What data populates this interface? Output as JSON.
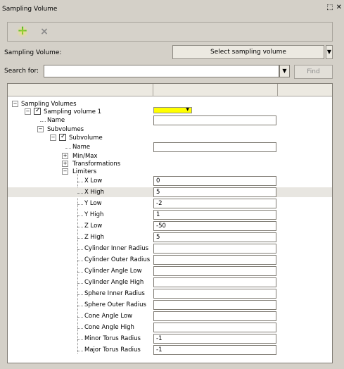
{
  "window": {
    "title": "Sampling Volume",
    "controls": [
      "⬚",
      "✕"
    ]
  },
  "toolbar": {
    "add_icon": "plus-icon",
    "remove_icon": "close-icon"
  },
  "form": {
    "sampling_volume_label": "Sampling Volume:",
    "select_button_label": "Select  sampling volume",
    "search_label": "Search for:",
    "search_value": "",
    "find_label": "Find"
  },
  "tree": {
    "root": "Sampling Volumes",
    "sampling_volume": "Sampling volume 1",
    "name": "Name",
    "subvolumes": "Subvolumes",
    "subvolume": "Subvolume",
    "subname": "Name",
    "minmax": "Min/Max",
    "transformations": "Transformations",
    "limiters": "Limiters",
    "limiter_rows": [
      {
        "label": "X Low",
        "value": "0"
      },
      {
        "label": "X High",
        "value": "5"
      },
      {
        "label": "Y Low",
        "value": "-2"
      },
      {
        "label": "Y High",
        "value": "1"
      },
      {
        "label": "Z Low",
        "value": "-50"
      },
      {
        "label": "Z High",
        "value": "5"
      },
      {
        "label": "Cylinder Inner Radius",
        "value": ""
      },
      {
        "label": "Cylinder Outer Radius",
        "value": ""
      },
      {
        "label": "Cylinder Angle Low",
        "value": ""
      },
      {
        "label": "Cylinder Angle High",
        "value": ""
      },
      {
        "label": "Sphere Inner Radius",
        "value": ""
      },
      {
        "label": "Sphere Outer Radius",
        "value": ""
      },
      {
        "label": "Cone Angle Low",
        "value": ""
      },
      {
        "label": "Cone Angle High",
        "value": ""
      },
      {
        "label": "Minor Torus Radius",
        "value": "-1"
      },
      {
        "label": "Major Torus Radius",
        "value": "-1"
      }
    ]
  },
  "colors": {
    "accent": "#ffff00",
    "add": "#32b41e",
    "panel": "#d4d0c8"
  }
}
